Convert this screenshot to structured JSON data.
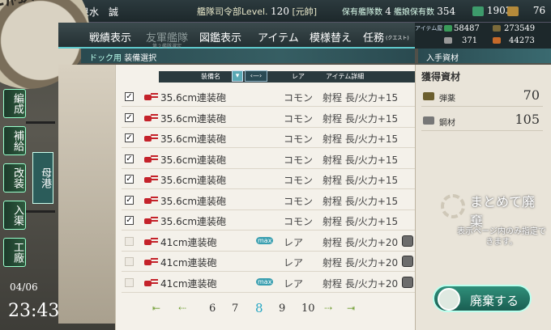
{
  "header": {
    "admiral_name": "泉水　誠",
    "hq_level_label": "艦隊司令部Level.",
    "hq_level": "120",
    "rank": "[元帥]",
    "ships_label": "保有艦隊数",
    "ships_count": "4",
    "ships_owned_label": "艦娘保有数",
    "ships_owned": "354",
    "bucket_value": "1903",
    "dev_value": "76"
  },
  "resources": {
    "fuel": "58487",
    "ammo": "273549",
    "steel": "371",
    "bauxite": "44273"
  },
  "menu": {
    "items": [
      "戦績表示",
      "友軍艦隊",
      "図鑑表示",
      "アイテム",
      "模様替え",
      "任務"
    ],
    "friend_fleet_sub": "第２艦隊選定",
    "quest_sub": "(クエスト)",
    "item_shop": "アイテム屋"
  },
  "breadcrumb": {
    "section": "ドック用",
    "current": "装備選択"
  },
  "list": {
    "headers": {
      "name": "装備名",
      "rarity": "レア",
      "detail": "アイテム詳細"
    },
    "rows": [
      {
        "name": "35.6cm連装砲",
        "rarity": "コモン",
        "detail": "射程 長/火力+15",
        "checked": true,
        "max": false
      },
      {
        "name": "35.6cm連装砲",
        "rarity": "コモン",
        "detail": "射程 長/火力+15",
        "checked": true,
        "max": false
      },
      {
        "name": "35.6cm連装砲",
        "rarity": "コモン",
        "detail": "射程 長/火力+15",
        "checked": true,
        "max": false
      },
      {
        "name": "35.6cm連装砲",
        "rarity": "コモン",
        "detail": "射程 長/火力+15",
        "checked": true,
        "max": false
      },
      {
        "name": "35.6cm連装砲",
        "rarity": "コモン",
        "detail": "射程 長/火力+15",
        "checked": true,
        "max": false
      },
      {
        "name": "35.6cm連装砲",
        "rarity": "コモン",
        "detail": "射程 長/火力+15",
        "checked": true,
        "max": false
      },
      {
        "name": "35.6cm連装砲",
        "rarity": "コモン",
        "detail": "射程 長/火力+15",
        "checked": true,
        "max": false
      },
      {
        "name": "41cm連装砲",
        "rarity": "レア",
        "detail": "射程 長/火力+20",
        "checked": false,
        "max": true
      },
      {
        "name": "41cm連装砲",
        "rarity": "レア",
        "detail": "射程 長/火力+20",
        "checked": false,
        "max": false
      },
      {
        "name": "41cm連装砲",
        "rarity": "レア",
        "detail": "射程 長/火力+20",
        "checked": false,
        "max": true
      }
    ],
    "max_label": "max"
  },
  "pager": {
    "pages": [
      "6",
      "7",
      "8",
      "9",
      "10"
    ],
    "current": "8"
  },
  "gains": {
    "tab": "入手資材",
    "title": "獲得資材",
    "items": [
      {
        "name": "弾薬",
        "value": "70"
      },
      {
        "name": "鋼材",
        "value": "105"
      }
    ],
    "bulk_title": "まとめて廃棄",
    "bulk_note": "表示ページ内のみ指定できます。",
    "scrap_button": "廃棄する"
  },
  "sidebar": {
    "hub": "工廠",
    "items": [
      "編成",
      "補給",
      "改装",
      "入渠",
      "工廠"
    ],
    "current": "母港"
  },
  "clock": {
    "date": "04/06",
    "time": "23:43"
  },
  "colors": {
    "accent": "#27a7c4",
    "panel": "#f4f1ea",
    "header": "#2a3a3e"
  }
}
